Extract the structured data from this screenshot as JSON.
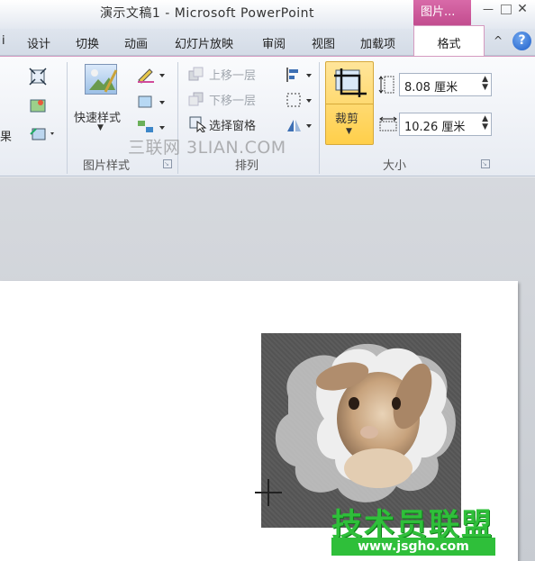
{
  "window": {
    "title": "演示文稿1 - Microsoft PowerPoint",
    "context_tab": "图片...",
    "controls": {
      "minimize": "—",
      "maximize": "",
      "close": "✕"
    }
  },
  "tabs": {
    "items": [
      {
        "label": "设计"
      },
      {
        "label": "切换"
      },
      {
        "label": "动画"
      },
      {
        "label": "幻灯片放映"
      },
      {
        "label": "审阅"
      },
      {
        "label": "视图"
      },
      {
        "label": "加载项"
      }
    ],
    "left_cut": "ⅰ",
    "active": "格式",
    "help": "?"
  },
  "ribbon": {
    "left_cut_label": "果",
    "picture_styles": {
      "quick_styles": "快速样式",
      "group_label": "图片样式"
    },
    "arrange": {
      "bring_forward": "上移一层",
      "send_backward": "下移一层",
      "selection_pane": "选择窗格",
      "group_label": "排列"
    },
    "size": {
      "crop": "裁剪",
      "height": "8.08 厘米",
      "width": "10.26 厘米",
      "group_label": "大小"
    }
  },
  "watermarks": {
    "top": "三联网 3LIAN.COM",
    "brand": "技术员联盟",
    "url": "www.jsgho.com"
  },
  "colors": {
    "context_accent": "#c14a8d",
    "crop_highlight": "#ffcf4a",
    "watermark_green": "#2fbf3a"
  }
}
